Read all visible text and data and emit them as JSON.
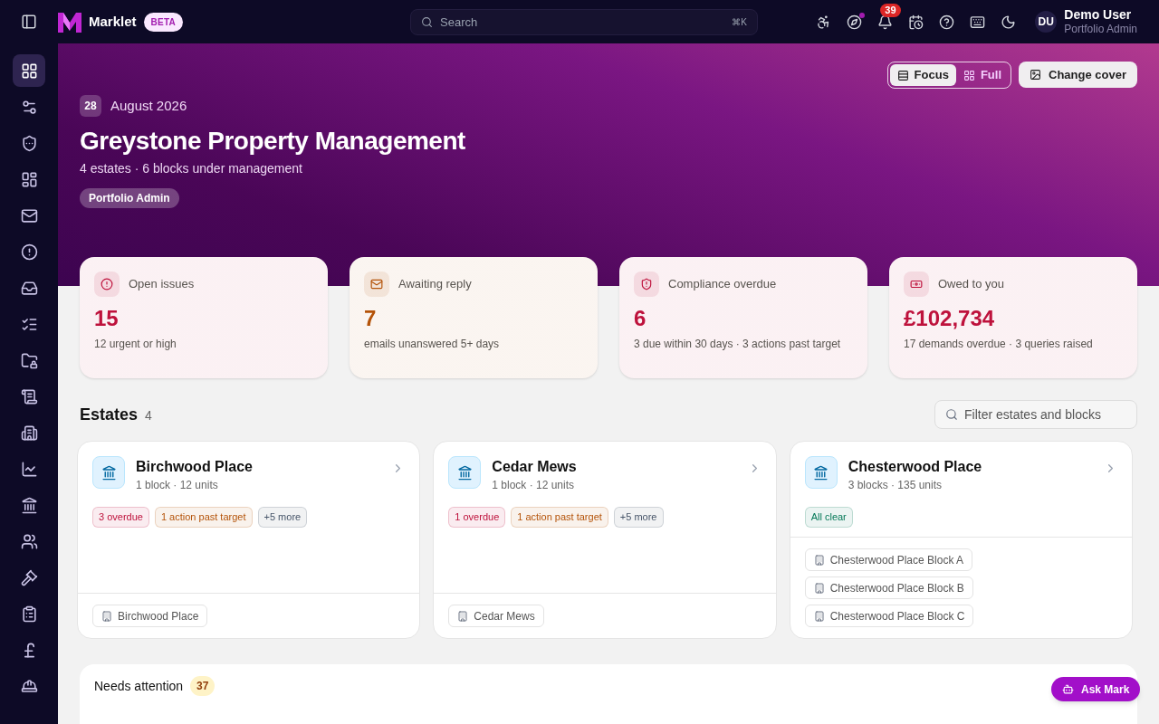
{
  "header": {
    "brand": "Marklet",
    "badge": "BETA",
    "search": {
      "placeholder": "Search",
      "shortcut": "⌘K"
    },
    "notifications": "39",
    "user": {
      "initials": "DU",
      "name": "Demo User",
      "role": "Portfolio Admin"
    }
  },
  "sidebar": {
    "items": [
      {
        "selected": true
      },
      {
        "selected": false
      },
      {
        "selected": false
      },
      {
        "selected": false
      },
      {
        "selected": false
      },
      {
        "selected": false
      },
      {
        "selected": false
      },
      {
        "selected": false
      },
      {
        "selected": false
      },
      {
        "selected": false
      },
      {
        "selected": false
      },
      {
        "selected": false
      },
      {
        "selected": false
      },
      {
        "selected": false
      },
      {
        "selected": false
      },
      {
        "selected": false
      },
      {
        "selected": false
      },
      {
        "selected": false
      }
    ]
  },
  "hero": {
    "day": "28",
    "date": "August 2026",
    "title": "Greystone Property Management",
    "subtitle": "4 estates · 6 blocks under management",
    "role": "Portfolio Admin",
    "view_toggle": [
      {
        "label": "Focus",
        "selected": true
      },
      {
        "label": "Full",
        "selected": false
      }
    ],
    "change_cover": "Change cover"
  },
  "stats": [
    {
      "label": "Open issues",
      "value": "15",
      "note": "12 urgent or high",
      "color": "#be123c"
    },
    {
      "label": "Awaiting reply",
      "value": "7",
      "note": "emails unanswered 5+ days",
      "color": "#b45309"
    },
    {
      "label": "Compliance overdue",
      "value": "6",
      "note": "3 due within 30 days · 3 actions past target",
      "color": "#be123c"
    },
    {
      "label": "Owed to you",
      "value": "£102,734",
      "note": "17 demands overdue · 3 queries raised",
      "color": "#be123c"
    }
  ],
  "estates": {
    "title": "Estates",
    "count": "4",
    "filter": {
      "placeholder": "Filter estates and blocks"
    },
    "cards": [
      {
        "name": "Birchwood Place",
        "meta": "1 block · 12 units",
        "tags": [
          {
            "label": "3 overdue",
            "color": "#be123c"
          },
          {
            "label": "1 action past target",
            "color": "#b45309"
          },
          {
            "label": "+5 more",
            "color": "#475569"
          }
        ],
        "blocks": [
          "Birchwood Place"
        ]
      },
      {
        "name": "Cedar Mews",
        "meta": "1 block · 12 units",
        "tags": [
          {
            "label": "1 overdue",
            "color": "#be123c"
          },
          {
            "label": "1 action past target",
            "color": "#b45309"
          },
          {
            "label": "+5 more",
            "color": "#475569"
          }
        ],
        "blocks": [
          "Cedar Mews"
        ]
      },
      {
        "name": "Chesterwood Place",
        "meta": "3 blocks · 135 units",
        "tags": [
          {
            "label": "All clear",
            "color": "#047857"
          }
        ],
        "blocks": [
          "Chesterwood Place Block A",
          "Chesterwood Place Block B",
          "Chesterwood Place Block C"
        ]
      }
    ]
  },
  "attention": {
    "title": "Needs attention",
    "count": "37"
  },
  "assistant": {
    "label": "Ask Mark"
  }
}
